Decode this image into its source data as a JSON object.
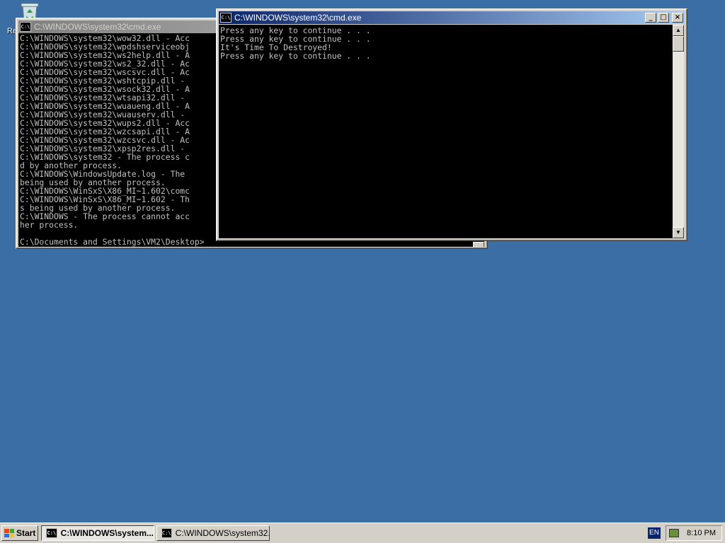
{
  "desktop": {
    "icon_label": "Re",
    "icon_name": "recycle-bin-icon"
  },
  "back_window": {
    "title": "C:\\WINDOWS\\system32\\cmd.exe",
    "lines": [
      "C:\\WINDOWS\\system32\\wow32.dll - Acc",
      "C:\\WINDOWS\\system32\\wpdshserviceobj",
      "C:\\WINDOWS\\system32\\ws2help.dll - A",
      "C:\\WINDOWS\\system32\\ws2_32.dll - Ac",
      "C:\\WINDOWS\\system32\\wscsvc.dll - Ac",
      "C:\\WINDOWS\\system32\\wshtcpip.dll -",
      "C:\\WINDOWS\\system32\\wsock32.dll - A",
      "C:\\WINDOWS\\system32\\wtsapi32.dll -",
      "C:\\WINDOWS\\system32\\wuaueng.dll - A",
      "C:\\WINDOWS\\system32\\wuauserv.dll -",
      "C:\\WINDOWS\\system32\\wups2.dll - Acc",
      "C:\\WINDOWS\\system32\\wzcsapi.dll - A",
      "C:\\WINDOWS\\system32\\wzcsvc.dll - Ac",
      "C:\\WINDOWS\\system32\\xpsp2res.dll -",
      "C:\\WINDOWS\\system32 - The process c",
      "d by another process.",
      "C:\\WINDOWS\\WindowsUpdate.log - The",
      "being used by another process.",
      "C:\\WINDOWS\\WinSxS\\X86_MI~1.602\\comc",
      "C:\\WINDOWS\\WinSxS\\X86_MI~1.602 - Th",
      "s being used by another process.",
      "C:\\WINDOWS - The process cannot acc",
      "her process.",
      "",
      "C:\\Documents and Settings\\VM2\\Desktop>"
    ]
  },
  "front_window": {
    "title": "C:\\WINDOWS\\system32\\cmd.exe",
    "lines": [
      "Press any key to continue . . .",
      "Press any key to continue . . .",
      "It's Time To Destroyed!",
      "Press any key to continue . . ."
    ],
    "buttons": {
      "minimize": "_",
      "maximize": "□",
      "close": "×"
    },
    "scroll_up": "▲",
    "scroll_down": "▼"
  },
  "taskbar": {
    "start_label": "Start",
    "tasks": [
      {
        "label": "C:\\WINDOWS\\system...",
        "state": "pressed"
      },
      {
        "label": "C:\\WINDOWS\\system32...",
        "state": "raised"
      }
    ],
    "language": "EN",
    "clock": "8:10 PM",
    "logo_colors": [
      "#e8471c",
      "#3ea52c",
      "#2b6ce0",
      "#f5c31a"
    ]
  },
  "colors": {
    "desktop": "#3a6ea5",
    "active_title": "#0a246a",
    "console_bg": "#000000",
    "console_text": "#c0c0c0"
  }
}
